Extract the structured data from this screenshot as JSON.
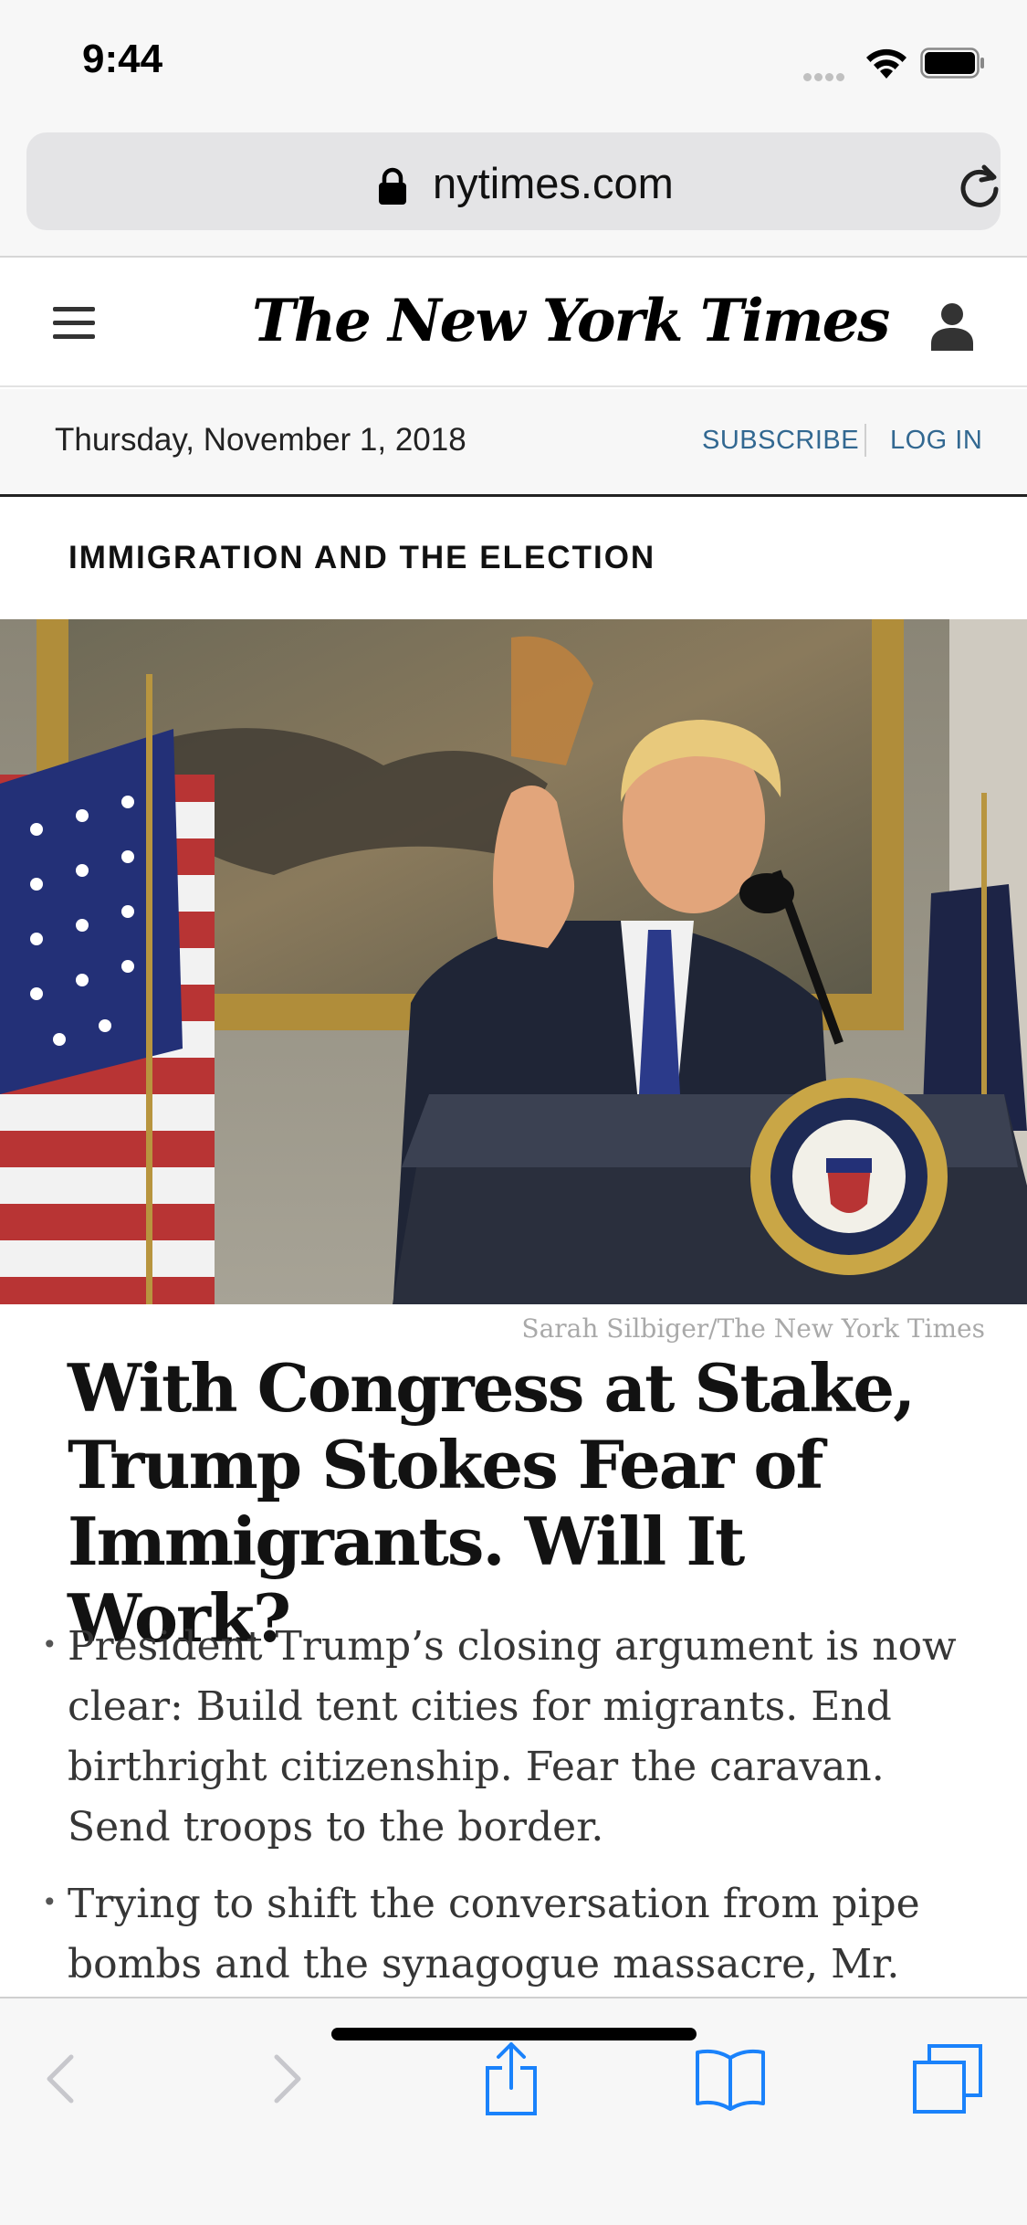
{
  "status_bar": {
    "time": "9:44"
  },
  "browser": {
    "url": "nytimes.com"
  },
  "masthead": {
    "logo_text": "The New York Times"
  },
  "date_bar": {
    "date": "Thursday, November 1, 2018",
    "subscribe": "SUBSCRIBE",
    "log_in": "LOG IN"
  },
  "article": {
    "kicker": "IMMIGRATION AND THE ELECTION",
    "photo_credit": "Sarah Silbiger/The New York Times",
    "headline": "With Congress at Stake, Trump Stokes Fear of Immigrants. Will It Work?",
    "summary": [
      "President Trump’s closing argument is now clear: Build tent cities for migrants. End birthright citizenship. Fear the caravan. Send troops to the border.",
      "Trying to shift the conversation from pipe bombs and the synagogue massacre, Mr."
    ]
  },
  "colors": {
    "link_blue": "#326891",
    "toolbar_blue": "#1a82fb",
    "disabled_gray": "#c7c7cc"
  },
  "icons": [
    "lock-icon",
    "reload-icon",
    "menu-icon",
    "account-icon",
    "back-icon",
    "forward-icon",
    "share-icon",
    "bookmarks-icon",
    "tabs-icon"
  ]
}
